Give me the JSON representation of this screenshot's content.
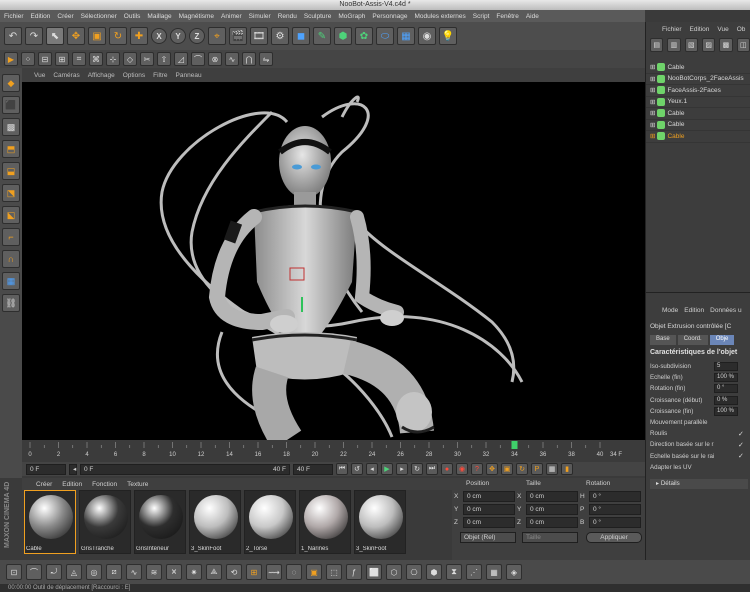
{
  "window_title": "NooBot-Assis-V4.c4d *",
  "menubar": [
    "Fichier",
    "Edition",
    "Créer",
    "Sélectionner",
    "Outils",
    "Maillage",
    "Magnétisme",
    "Animer",
    "Simuler",
    "Rendu",
    "Sculpture",
    "MoGraph",
    "Personnage",
    "Modules externes",
    "Script",
    "Fenêtre",
    "Aide"
  ],
  "axis_buttons": [
    "X",
    "Y",
    "Z"
  ],
  "viewport_menu": [
    "Vue",
    "Caméras",
    "Affichage",
    "Options",
    "Filtre",
    "Panneau"
  ],
  "timeline": {
    "ticks": [
      "0",
      "2",
      "4",
      "6",
      "8",
      "10",
      "12",
      "14",
      "16",
      "18",
      "20",
      "22",
      "24",
      "26",
      "28",
      "30",
      "32",
      "34",
      "36",
      "38",
      "40"
    ],
    "current": "34 F"
  },
  "transport": {
    "start_field": "0 F",
    "range_start": "0 F",
    "range_end": "40 F",
    "end_field": "40 F"
  },
  "materials_menu": [
    "Créer",
    "Edition",
    "Fonction",
    "Texture"
  ],
  "materials": [
    {
      "name": "Cable",
      "color": "#8a8a8a"
    },
    {
      "name": "GrisTranche",
      "color": "#3a3a3a"
    },
    {
      "name": "GrisInterieur",
      "color": "#2e2e2e"
    },
    {
      "name": "3_SkinFoot",
      "color": "#bdbdbd"
    },
    {
      "name": "2_Torse",
      "color": "#c8c8c8"
    },
    {
      "name": "1_Narines",
      "color": "#b0a8a8"
    },
    {
      "name": "3_SkinFoot",
      "color": "#bdbdbd"
    }
  ],
  "coords": {
    "headers": [
      "Position",
      "Taille",
      "Rotation"
    ],
    "rows": [
      {
        "a": "X",
        "pos": "0 cm",
        "b": "X",
        "size": "0 cm",
        "c": "H",
        "rot": "0 °"
      },
      {
        "a": "Y",
        "pos": "0 cm",
        "b": "Y",
        "size": "0 cm",
        "c": "P",
        "rot": "0 °"
      },
      {
        "a": "Z",
        "pos": "0 cm",
        "b": "Z",
        "size": "0 cm",
        "c": "B",
        "rot": "0 °"
      }
    ],
    "mode_select": "Objet (Rel)",
    "size_select": "Taille",
    "apply_button": "Appliquer"
  },
  "object_manager": {
    "menu": [
      "Fichier",
      "Edition",
      "Vue",
      "Ob"
    ],
    "items": [
      {
        "label": "Cable",
        "highlight": false
      },
      {
        "label": "NooBotCorps_2FaceAssis",
        "highlight": false
      },
      {
        "label": "FaceAssis-2Faces",
        "highlight": false
      },
      {
        "label": "Yeux.1",
        "highlight": false
      },
      {
        "label": "Cable",
        "highlight": false
      },
      {
        "label": "Cable",
        "highlight": false
      },
      {
        "label": "Cable",
        "highlight": true
      }
    ]
  },
  "attributes": {
    "menu": [
      "Mode",
      "Edition",
      "Données u"
    ],
    "object_label": "Objet Extrusion contrôlée [C",
    "tabs": [
      "Base",
      "Coord.",
      "Obje"
    ],
    "section": "Caractéristiques de l'objet",
    "rows": [
      {
        "k": "Iso-subdivision",
        "v": "5",
        "type": "field"
      },
      {
        "k": "Echelle (fin)",
        "v": "100 %",
        "type": "field"
      },
      {
        "k": "Rotation (fin)",
        "v": "0 °",
        "type": "field"
      },
      {
        "k": "Croissance (début)",
        "v": "0 %",
        "type": "field"
      },
      {
        "k": "Croissance (fin)",
        "v": "100 %",
        "type": "field"
      },
      {
        "k": "Mouvement parallèle",
        "v": "",
        "type": "check"
      },
      {
        "k": "Roulis",
        "v": "✓",
        "type": "check"
      },
      {
        "k": "Direction basée sur le rail",
        "v": "✓",
        "type": "check"
      },
      {
        "k": "Echelle basée sur le rail",
        "v": "✓",
        "type": "check"
      },
      {
        "k": "Adapter les UV",
        "v": "",
        "type": "check"
      }
    ],
    "details": "Détails"
  },
  "status_text": "00:00:00    Outil de déplacement [Raccourci : E]",
  "maxon_label": "MAXON CINEMA 4D"
}
